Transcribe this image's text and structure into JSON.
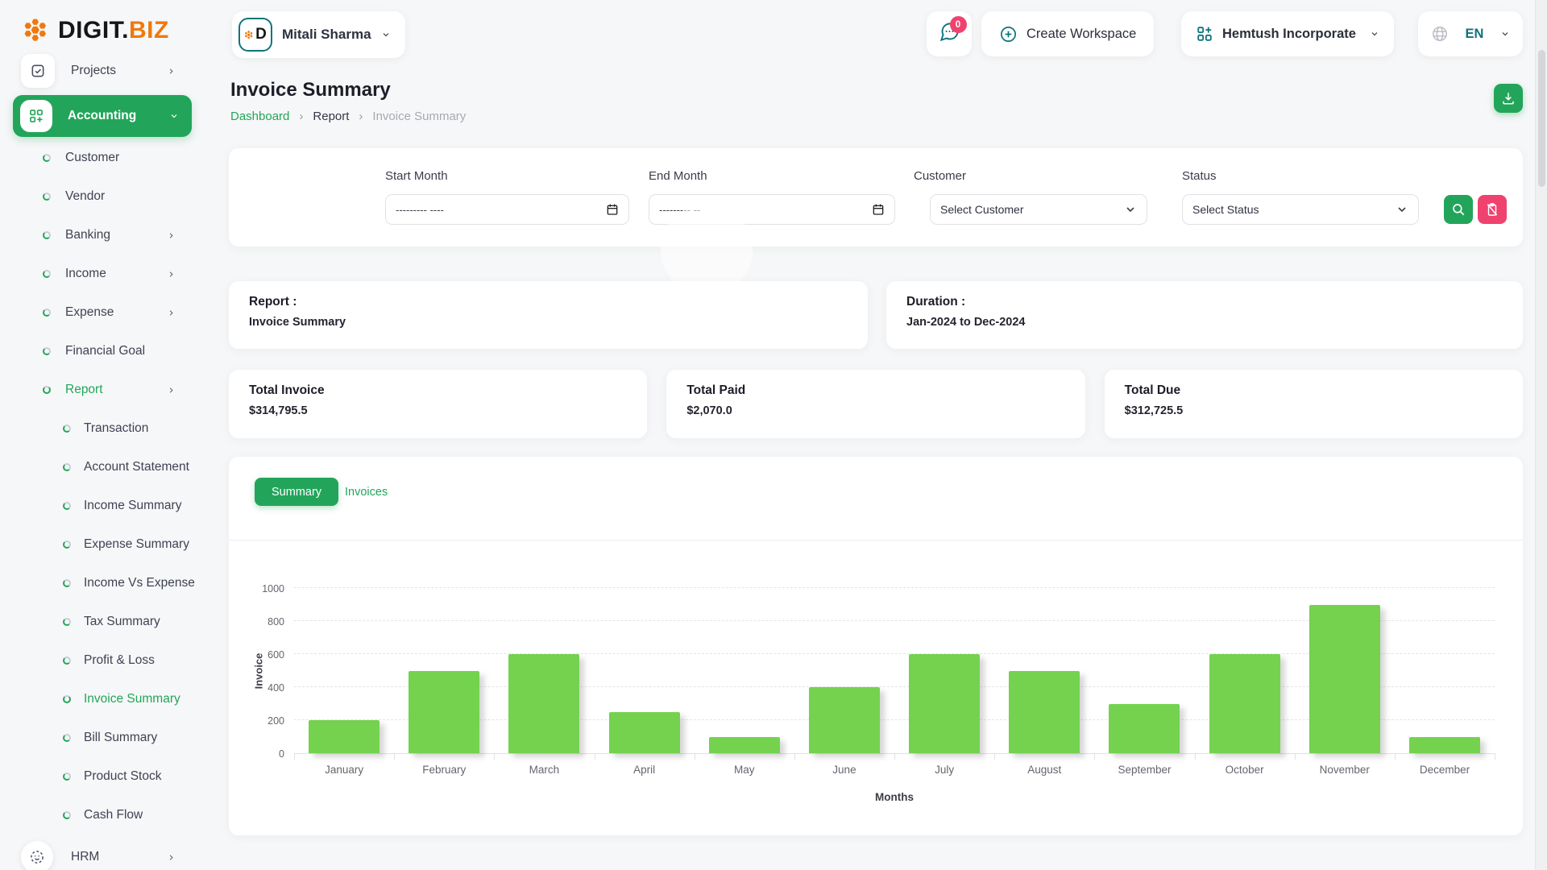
{
  "brand": {
    "text_dark": "DIGIT.",
    "text_orange": "BIZ",
    "orange": "#f0780c"
  },
  "header": {
    "user_name": "Mitali Sharma",
    "chat_badge": "0",
    "create_workspace_label": "Create Workspace",
    "company_name": "Hemtush Incorporate",
    "language": "EN"
  },
  "sidebar": {
    "projects_label": "Projects",
    "accounting_label": "Accounting",
    "accounting_items": [
      {
        "label": "Customer",
        "chevron": false,
        "active": false
      },
      {
        "label": "Vendor",
        "chevron": false,
        "active": false
      },
      {
        "label": "Banking",
        "chevron": true,
        "active": false
      },
      {
        "label": "Income",
        "chevron": true,
        "active": false
      },
      {
        "label": "Expense",
        "chevron": true,
        "active": false
      },
      {
        "label": "Financial Goal",
        "chevron": false,
        "active": false
      },
      {
        "label": "Report",
        "chevron": true,
        "active": true
      }
    ],
    "report_items": [
      {
        "label": "Transaction",
        "active": false
      },
      {
        "label": "Account Statement",
        "active": false
      },
      {
        "label": "Income Summary",
        "active": false
      },
      {
        "label": "Expense Summary",
        "active": false
      },
      {
        "label": "Income Vs Expense",
        "active": false
      },
      {
        "label": "Tax Summary",
        "active": false
      },
      {
        "label": "Profit & Loss",
        "active": false
      },
      {
        "label": "Invoice Summary",
        "active": true
      },
      {
        "label": "Bill Summary",
        "active": false
      },
      {
        "label": "Product Stock",
        "active": false
      },
      {
        "label": "Cash Flow",
        "active": false
      }
    ],
    "hrm_label": "HRM"
  },
  "page": {
    "title": "Invoice Summary",
    "breadcrumb": [
      "Dashboard",
      "Report",
      "Invoice Summary"
    ]
  },
  "filters": {
    "start_month_label": "Start Month",
    "start_month_value": "--------- ----",
    "end_month_label": "End Month",
    "end_month_value": "--------- --",
    "customer_label": "Customer",
    "customer_value": "Select Customer",
    "status_label": "Status",
    "status_value": "Select Status"
  },
  "summary": {
    "report_label": "Report :",
    "report_value": "Invoice Summary",
    "duration_label": "Duration :",
    "duration_value": "Jan-2024 to Dec-2024"
  },
  "totals": [
    {
      "label": "Total Invoice",
      "value": "$314,795.5"
    },
    {
      "label": "Total Paid",
      "value": "$2,070.0"
    },
    {
      "label": "Total Due",
      "value": "$312,725.5"
    }
  ],
  "tabs": [
    {
      "label": "Summary",
      "active": true
    },
    {
      "label": "Invoices",
      "active": false
    }
  ],
  "chart_data": {
    "type": "bar",
    "categories": [
      "January",
      "February",
      "March",
      "April",
      "May",
      "June",
      "July",
      "August",
      "September",
      "October",
      "November",
      "December"
    ],
    "values": [
      200,
      500,
      600,
      250,
      100,
      400,
      600,
      500,
      300,
      600,
      900,
      100
    ],
    "title": "",
    "xlabel": "Months",
    "ylabel": "Invoice",
    "ylim": [
      0,
      1000
    ],
    "yticks": [
      0,
      200,
      400,
      600,
      800,
      1000
    ],
    "bar_color": "#74d24f",
    "grid": "dashed-horizontal",
    "legend": "none"
  },
  "colors": {
    "accent_green": "#22a55a",
    "bar_green": "#74d24f",
    "danger_pink": "#f0426e",
    "icon_teal": "#0f737d",
    "brand_orange": "#f0780c"
  }
}
